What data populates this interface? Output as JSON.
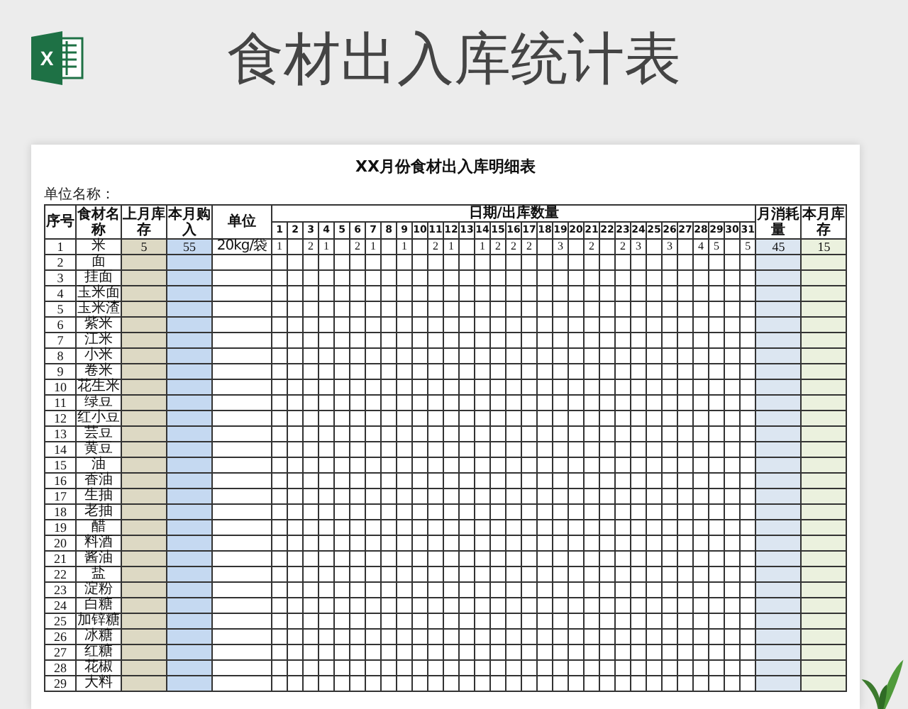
{
  "header": {
    "logo_letter": "X",
    "title": "食材出入库统计表"
  },
  "sheet": {
    "title": "XX月份食材出入库明细表",
    "org_label": "单位名称：",
    "columns": {
      "no": "序号",
      "name": "食材名称",
      "last_stock": "上月库存",
      "purchased": "本月购入",
      "unit": "单位",
      "days_group": "日期/出库数量",
      "monthly_use": "月消耗量",
      "stock": "本月库存"
    },
    "days": [
      "1",
      "2",
      "3",
      "4",
      "5",
      "6",
      "7",
      "8",
      "9",
      "10",
      "11",
      "12",
      "13",
      "14",
      "15",
      "16",
      "17",
      "18",
      "19",
      "20",
      "21",
      "22",
      "23",
      "24",
      "25",
      "26",
      "27",
      "28",
      "29",
      "30",
      "31"
    ],
    "rows": [
      {
        "no": "1",
        "name": "米",
        "last_stock": "5",
        "purchased": "55",
        "unit": "20kg/袋",
        "daily_out": {
          "d1": "1",
          "d3": "2",
          "d4": "1",
          "d6": "2",
          "d7": "1",
          "d9": "1",
          "d11": "2",
          "d12": "1",
          "d14": "1",
          "d15": "2",
          "d16": "2",
          "d17": "2",
          "d19": "3",
          "d21": "2",
          "d23": "2",
          "d24": "3",
          "d26": "3",
          "d28": "4",
          "d29": "5",
          "d31": "5"
        },
        "monthly_use": "45",
        "stock": "15"
      },
      {
        "no": "2",
        "name": "面"
      },
      {
        "no": "3",
        "name": "挂面"
      },
      {
        "no": "4",
        "name": "玉米面"
      },
      {
        "no": "5",
        "name": "玉米渣"
      },
      {
        "no": "6",
        "name": "紫米"
      },
      {
        "no": "7",
        "name": "江米"
      },
      {
        "no": "8",
        "name": "小米"
      },
      {
        "no": "9",
        "name": "卷米"
      },
      {
        "no": "10",
        "name": "花生米"
      },
      {
        "no": "11",
        "name": "绿豆"
      },
      {
        "no": "12",
        "name": "红小豆"
      },
      {
        "no": "13",
        "name": "芸豆"
      },
      {
        "no": "14",
        "name": "黄豆"
      },
      {
        "no": "15",
        "name": "油"
      },
      {
        "no": "16",
        "name": "香油"
      },
      {
        "no": "17",
        "name": "生抽"
      },
      {
        "no": "18",
        "name": "老抽"
      },
      {
        "no": "19",
        "name": "醋"
      },
      {
        "no": "20",
        "name": "料酒"
      },
      {
        "no": "21",
        "name": "酱油"
      },
      {
        "no": "22",
        "name": "盐"
      },
      {
        "no": "23",
        "name": "淀粉"
      },
      {
        "no": "24",
        "name": "白糖"
      },
      {
        "no": "25",
        "name": "加锌糖"
      },
      {
        "no": "26",
        "name": "冰糖"
      },
      {
        "no": "27",
        "name": "红糖"
      },
      {
        "no": "28",
        "name": "花椒"
      },
      {
        "no": "29",
        "name": "大料"
      }
    ]
  }
}
